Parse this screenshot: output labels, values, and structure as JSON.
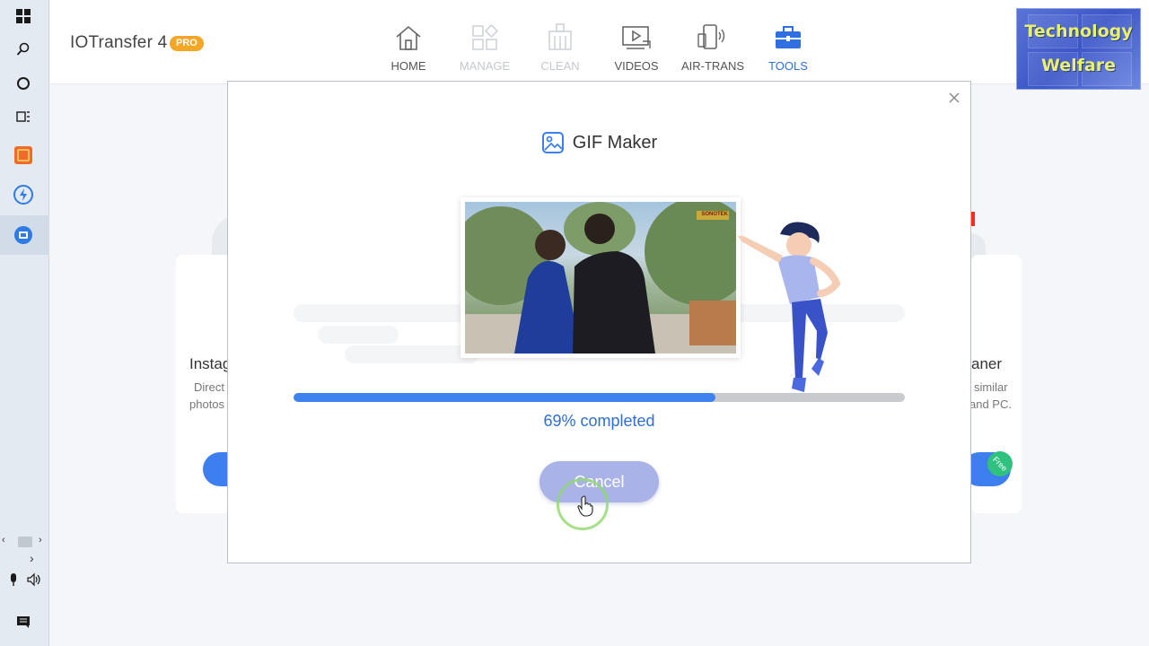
{
  "app": {
    "title": "IOTransfer 4",
    "badge": "PRO"
  },
  "nav": [
    {
      "label": "HOME",
      "icon": "home-icon",
      "state": "normal"
    },
    {
      "label": "MANAGE",
      "icon": "manage-icon",
      "state": "disabled"
    },
    {
      "label": "CLEAN",
      "icon": "clean-icon",
      "state": "disabled"
    },
    {
      "label": "VIDEOS",
      "icon": "videos-icon",
      "state": "normal"
    },
    {
      "label": "AIR-TRANS",
      "icon": "air-trans-icon",
      "state": "normal"
    },
    {
      "label": "TOOLS",
      "icon": "tools-icon",
      "state": "active"
    }
  ],
  "watermark": {
    "line1": "Technology",
    "line2": "Welfare"
  },
  "background_cards": {
    "left_title": "Instag",
    "left_desc_1": "Direct",
    "left_desc_2": "photos",
    "right_title": "aner",
    "right_desc_1": "similar",
    "right_desc_2": "and PC.",
    "right_ribbon": "Free"
  },
  "modal": {
    "title": "GIF Maker",
    "preview_logo": "SONOTEK",
    "progress_percent": 69,
    "progress_text": "69% completed",
    "cancel_label": "Cancel"
  },
  "colors": {
    "accent": "#3e82f0",
    "cancel_bg": "#a9b3e8",
    "progress_track": "#c9cacd",
    "pro_badge": "#f5a623"
  }
}
